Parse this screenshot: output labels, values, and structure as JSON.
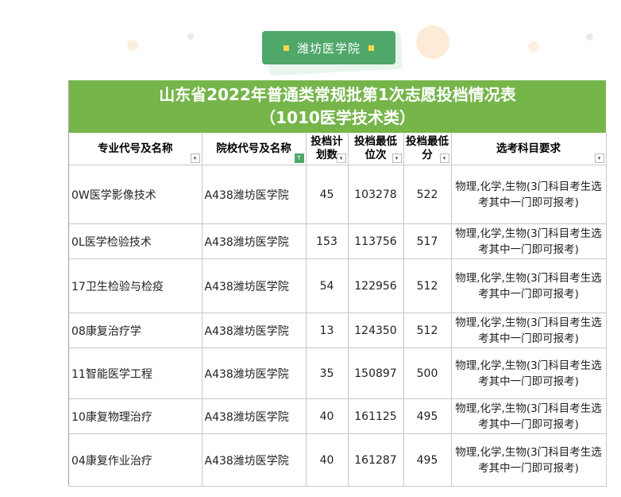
{
  "tag": {
    "label": "潍坊医学院"
  },
  "table": {
    "title_line1": "山东省2022年普通类常规批第1次志愿投档情况表",
    "title_line2": "（1010医学技术类）",
    "headers": [
      "专业代号及名称",
      "院校代号及名称",
      "投档计划数",
      "投档最低位次",
      "投档最低分",
      "选考科目要求"
    ],
    "rows": [
      [
        "0W医学影像技术",
        "A438潍坊医学院",
        "45",
        "103278",
        "522",
        "物理,化学,生物(3门科目考生选考其中一门即可报考)"
      ],
      [
        "0L医学检验技术",
        "A438潍坊医学院",
        "153",
        "113756",
        "517",
        "物理,化学,生物(3门科目考生选考其中一门即可报考)"
      ],
      [
        "17卫生检验与检疫",
        "A438潍坊医学院",
        "54",
        "122956",
        "512",
        "物理,化学,生物(3门科目考生选考其中一门即可报考)"
      ],
      [
        "08康复治疗学",
        "A438潍坊医学院",
        "13",
        "124350",
        "512",
        "物理,化学,生物(3门科目考生选考其中一门即可报考)"
      ],
      [
        "11智能医学工程",
        "A438潍坊医学院",
        "35",
        "150897",
        "500",
        "物理,化学,生物(3门科目考生选考其中一门即可报考)"
      ],
      [
        "10康复物理治疗",
        "A438潍坊医学院",
        "40",
        "161125",
        "495",
        "物理,化学,生物(3门科目考生选考其中一门即可报考)"
      ],
      [
        "04康复作业治疗",
        "A438潍坊医学院",
        "40",
        "161287",
        "495",
        "物理,化学,生物(3门科目考生选考其中一门即可报考)"
      ]
    ]
  },
  "colors": {
    "title_bg": "#76b54a",
    "tag_bg": "#4fa86a",
    "tag_marker": "#ffd84a"
  }
}
